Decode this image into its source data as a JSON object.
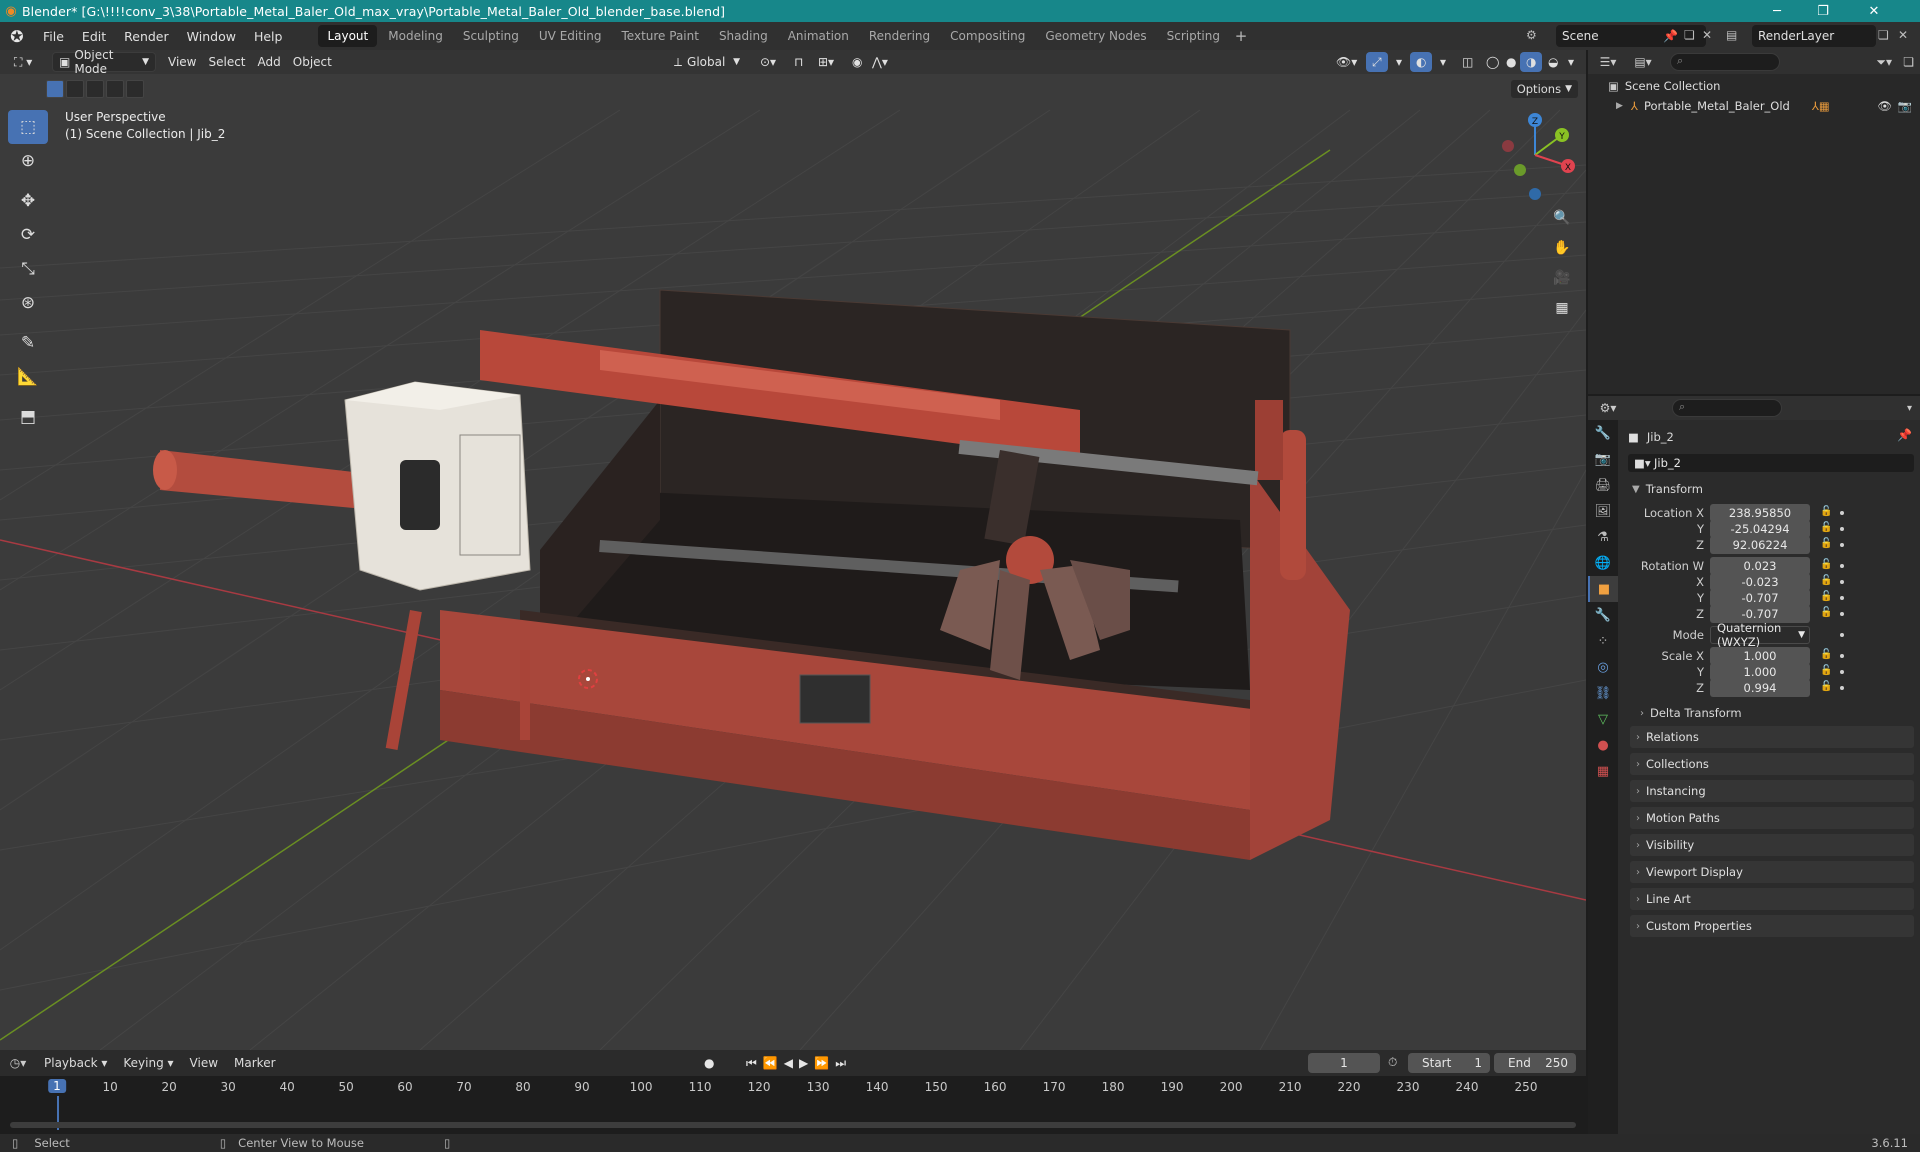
{
  "window": {
    "title": "Blender* [G:\\!!!!conv_3\\38\\Portable_Metal_Baler_Old_max_vray\\Portable_Metal_Baler_Old_blender_base.blend]"
  },
  "menu": [
    "File",
    "Edit",
    "Render",
    "Window",
    "Help"
  ],
  "workspaces": [
    "Layout",
    "Modeling",
    "Sculpting",
    "UV Editing",
    "Texture Paint",
    "Shading",
    "Animation",
    "Rendering",
    "Compositing",
    "Geometry Nodes",
    "Scripting"
  ],
  "active_workspace": "Layout",
  "scene": "Scene",
  "render_layer": "RenderLayer",
  "viewport": {
    "mode": "Object Mode",
    "header_menus": [
      "View",
      "Select",
      "Add",
      "Object"
    ],
    "transform_orientation": "Global",
    "options_label": "Options",
    "overlay_line1": "User Perspective",
    "overlay_line2": "(1) Scene Collection | Jib_2",
    "gizmo_axes": [
      "X",
      "Y",
      "Z"
    ]
  },
  "outliner": {
    "root": "Scene Collection",
    "items": [
      "Portable_Metal_Baler_Old"
    ]
  },
  "properties": {
    "object_name": "Jib_2",
    "data_name": "Jib_2",
    "transform_label": "Transform",
    "location": {
      "label": "Location X",
      "x": "238.95850",
      "y": "-25.04294",
      "z": "92.06224"
    },
    "rotation": {
      "label": "Rotation W",
      "w": "0.023",
      "x": "-0.023",
      "y": "-0.707",
      "z": "-0.707"
    },
    "mode_label": "Mode",
    "mode_value": "Quaternion (WXYZ)",
    "scale": {
      "label": "Scale X",
      "x": "1.000",
      "y": "1.000",
      "z": "0.994"
    },
    "axis_labels": {
      "y": "Y",
      "z": "Z",
      "x": "X"
    },
    "delta_transform": "Delta Transform",
    "panels": [
      "Relations",
      "Collections",
      "Instancing",
      "Motion Paths",
      "Visibility",
      "Viewport Display",
      "Line Art",
      "Custom Properties"
    ]
  },
  "timeline": {
    "menus": [
      "Playback",
      "Keying",
      "View",
      "Marker"
    ],
    "current_frame": "1",
    "start_label": "Start",
    "start": "1",
    "end_label": "End",
    "end": "250",
    "ticks": [
      "1",
      "10",
      "20",
      "30",
      "40",
      "50",
      "60",
      "70",
      "80",
      "90",
      "100",
      "110",
      "120",
      "130",
      "140",
      "150",
      "160",
      "170",
      "180",
      "190",
      "200",
      "210",
      "220",
      "230",
      "240",
      "250"
    ]
  },
  "statusbar": {
    "select": "Select",
    "center": "Center View to Mouse",
    "version": "3.6.11"
  },
  "colors": {
    "accent": "#4772b3",
    "titlebar": "#17878a",
    "machine_red": "#b9473a",
    "axis_x": "#e0434f",
    "axis_y": "#8ac224",
    "axis_z": "#3d86d6"
  }
}
